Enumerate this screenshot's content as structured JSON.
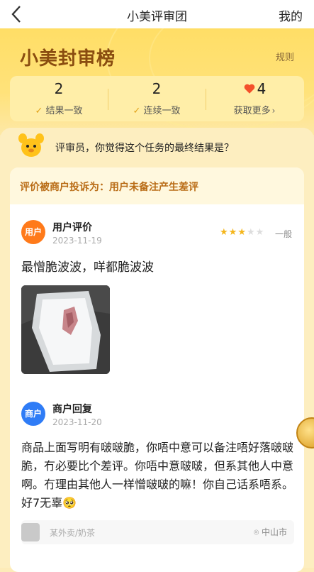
{
  "nav": {
    "title": "小美评审团",
    "mine": "我的"
  },
  "hero": {
    "brand": "小美封审榜",
    "rules": "规则"
  },
  "stats": [
    {
      "value": "2",
      "label": "结果一致"
    },
    {
      "value": "2",
      "label": "连续一致"
    },
    {
      "value": "4",
      "label": "获取更多"
    }
  ],
  "question": "评审员，你觉得这个任务的最终结果是？",
  "complaint": "评价被商户投诉为：用户未备注产生差评",
  "user_review": {
    "avatar": "用户",
    "title": "用户评价",
    "date": "2023-11-19",
    "rating": 3,
    "rating_max": 5,
    "rating_label": "一般",
    "text": "最憎脆波波，咩都脆波波"
  },
  "merchant_reply": {
    "avatar": "商户",
    "title": "商户回复",
    "date": "2023-11-20",
    "text": "商品上面写明有啵啵脆，你唔中意可以备注唔好落啵啵脆，冇必要比个差评。你唔中意啵啵，但系其他人中意啊。冇理由其他人一样憎啵啵的嘛！你自己话系唔系。好7无辜🥺"
  },
  "footer": {
    "shop": "某外卖/奶茶",
    "location": "中山市"
  },
  "colors": {
    "accent": "#ffd84d",
    "brand_text": "#8a4d10",
    "user_avatar": "#ff7a1a",
    "merchant_avatar": "#2f7cf6",
    "star": "#f4b51a",
    "heart": "#f4502a"
  },
  "icons": [
    "back-icon",
    "check-icon",
    "heart-icon",
    "chevron-right-icon",
    "mascot-icon",
    "star-icon",
    "shop-icon",
    "location-icon",
    "coin-icon"
  ]
}
